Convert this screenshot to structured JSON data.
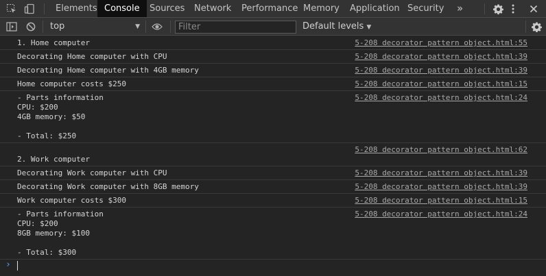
{
  "tabs": [
    {
      "label": "Elements"
    },
    {
      "label": "Console"
    },
    {
      "label": "Sources"
    },
    {
      "label": "Network"
    },
    {
      "label": "Performance"
    },
    {
      "label": "Memory"
    },
    {
      "label": "Application"
    },
    {
      "label": "Security"
    }
  ],
  "more_tabs": "»",
  "toolbar": {
    "context": "top",
    "filter_placeholder": "Filter",
    "levels": "Default levels"
  },
  "messages": [
    {
      "text": "1. Home computer",
      "source": "5-208 decorator pattern object.html:55"
    },
    {
      "text": "Decorating Home computer with CPU",
      "source": "5-208 decorator pattern object.html:39"
    },
    {
      "text": "Decorating Home computer with 4GB memory",
      "source": "5-208 decorator pattern object.html:39"
    },
    {
      "text": "Home computer costs $250",
      "source": "5-208 decorator pattern object.html:15"
    },
    {
      "text": "- Parts information\nCPU: $200\n4GB memory: $50\n\n- Total: $250",
      "source": "5-208 decorator pattern object.html:24"
    },
    {
      "text": "",
      "source": "5-208 decorator pattern object.html:62"
    },
    {
      "text": "2. Work computer",
      "source": ""
    },
    {
      "text": "Decorating Work computer with CPU",
      "source": "5-208 decorator pattern object.html:39"
    },
    {
      "text": "Decorating Work computer with 8GB memory",
      "source": "5-208 decorator pattern object.html:39"
    },
    {
      "text": "Work computer costs $300",
      "source": "5-208 decorator pattern object.html:15"
    },
    {
      "text": "- Parts information\nCPU: $200\n8GB memory: $100\n\n- Total: $300",
      "source": "5-208 decorator pattern object.html:24"
    }
  ],
  "prompt_symbol": "›",
  "colors": {
    "accent": "#4fa3ff",
    "background": "#242424",
    "toolbar": "#333333"
  }
}
